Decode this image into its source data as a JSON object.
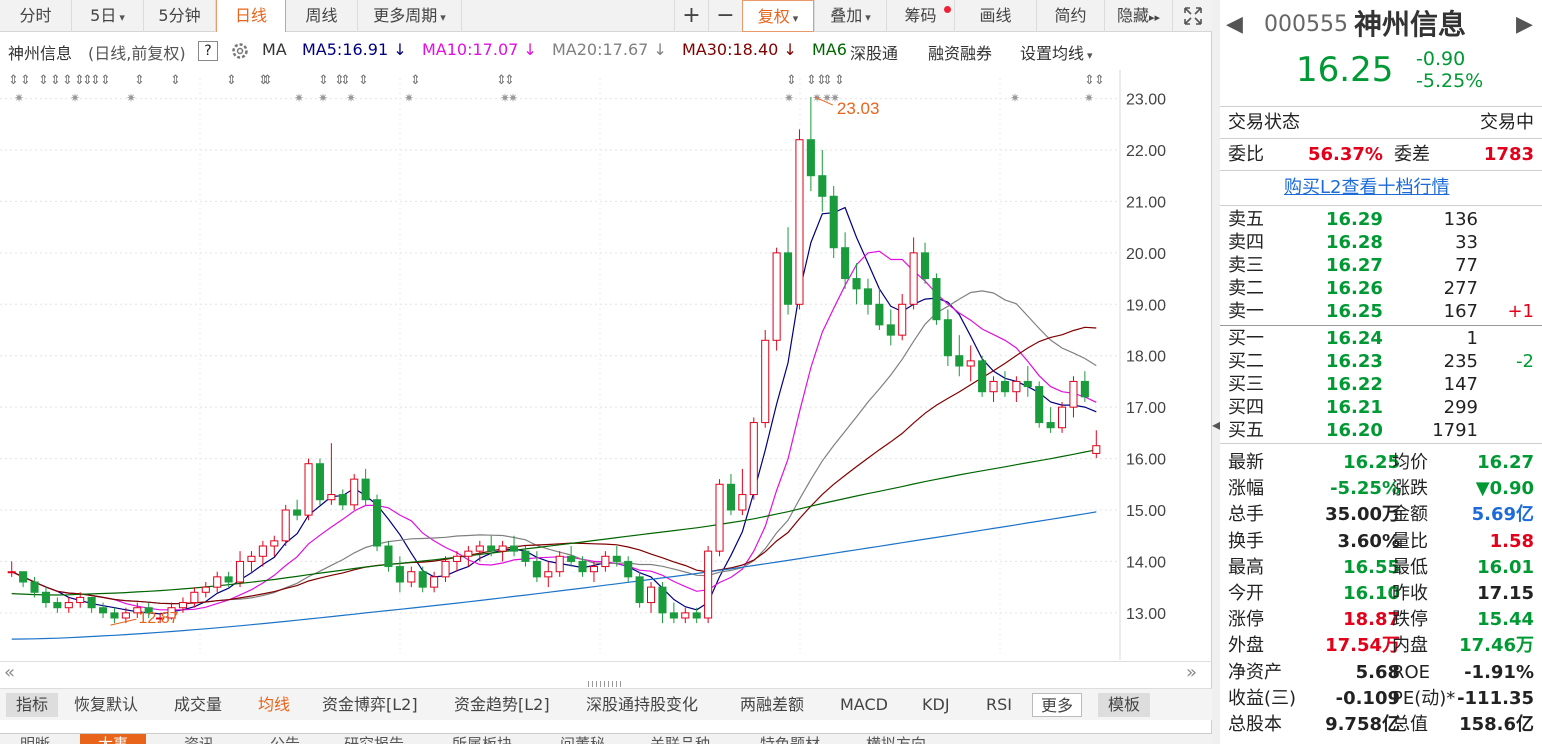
{
  "toolbar": {
    "tabs": [
      "分时",
      "5日",
      "5分钟",
      "日线",
      "周线",
      "更多周期"
    ],
    "plus": "+",
    "minus": "−",
    "fuquan": "复权",
    "overlay": "叠加",
    "chips": "筹码",
    "draw": "画线",
    "simple": "简约",
    "hide": "隐藏",
    "expand_icon": "expand-arrows"
  },
  "ma_bar": {
    "stock": "神州信息",
    "mode": "(日线,前复权)",
    "help": "?",
    "ma": "MA",
    "ma5": "MA5:16.91",
    "ma10": "MA10:17.07",
    "ma20": "MA20:17.67",
    "ma30": "MA30:18.40",
    "ma60": "MA6",
    "sgt": "深股通",
    "rzrq": "融资融券",
    "setma": "设置均线"
  },
  "colors": {
    "up": "#e2001a",
    "down": "#1a9b3c",
    "ma5": "#000080",
    "ma10": "#e010e0",
    "ma20": "#808080",
    "ma30": "#800000",
    "ma60": "#006600",
    "ma120": "#1c73c8",
    "accent": "#e8641b"
  },
  "chart_data": {
    "type": "candlestick",
    "y_ticks": [
      "23.00",
      "22.00",
      "21.00",
      "20.00",
      "19.00",
      "18.00",
      "17.00",
      "16.00",
      "15.00",
      "14.00",
      "13.00"
    ],
    "ylim": [
      12.2,
      23.4
    ],
    "high_label": "23.03",
    "low_label": "12.87",
    "candles": [
      [
        13.8,
        14.0,
        13.7,
        13.8
      ],
      [
        13.8,
        13.8,
        13.5,
        13.6
      ],
      [
        13.6,
        13.7,
        13.3,
        13.4
      ],
      [
        13.4,
        13.5,
        13.1,
        13.2
      ],
      [
        13.2,
        13.3,
        13.0,
        13.1
      ],
      [
        13.1,
        13.3,
        13.0,
        13.2
      ],
      [
        13.2,
        13.4,
        13.1,
        13.3
      ],
      [
        13.3,
        13.3,
        13.0,
        13.1
      ],
      [
        13.1,
        13.2,
        12.9,
        13.0
      ],
      [
        13.0,
        13.1,
        12.8,
        12.9
      ],
      [
        12.9,
        13.1,
        12.8,
        13.0
      ],
      [
        13.0,
        13.2,
        12.9,
        13.1
      ],
      [
        13.1,
        13.2,
        12.9,
        13.0
      ],
      [
        12.9,
        13.0,
        12.8,
        12.9
      ],
      [
        12.9,
        13.2,
        12.87,
        13.1
      ],
      [
        13.1,
        13.3,
        13.0,
        13.2
      ],
      [
        13.2,
        13.5,
        13.1,
        13.4
      ],
      [
        13.4,
        13.6,
        13.3,
        13.5
      ],
      [
        13.5,
        13.8,
        13.4,
        13.7
      ],
      [
        13.7,
        13.8,
        13.5,
        13.6
      ],
      [
        13.6,
        14.2,
        13.5,
        14.0
      ],
      [
        14.0,
        14.2,
        13.8,
        14.1
      ],
      [
        14.1,
        14.4,
        13.9,
        14.3
      ],
      [
        14.3,
        14.5,
        14.1,
        14.4
      ],
      [
        14.4,
        15.1,
        14.3,
        15.0
      ],
      [
        15.0,
        15.2,
        14.8,
        14.9
      ],
      [
        14.9,
        16.0,
        14.8,
        15.9
      ],
      [
        15.9,
        16.0,
        15.1,
        15.2
      ],
      [
        15.2,
        16.3,
        15.1,
        15.3
      ],
      [
        15.3,
        15.4,
        15.0,
        15.1
      ],
      [
        15.1,
        15.7,
        15.0,
        15.6
      ],
      [
        15.6,
        15.8,
        15.1,
        15.2
      ],
      [
        15.2,
        15.3,
        14.2,
        14.3
      ],
      [
        14.3,
        14.4,
        13.8,
        13.9
      ],
      [
        13.9,
        14.1,
        13.4,
        13.6
      ],
      [
        13.6,
        13.9,
        13.5,
        13.8
      ],
      [
        13.8,
        13.9,
        13.4,
        13.5
      ],
      [
        13.5,
        13.8,
        13.4,
        13.7
      ],
      [
        13.7,
        14.1,
        13.6,
        14.0
      ],
      [
        14.0,
        14.2,
        13.8,
        14.1
      ],
      [
        14.1,
        14.3,
        13.9,
        14.2
      ],
      [
        14.2,
        14.4,
        14.0,
        14.3
      ],
      [
        14.3,
        14.5,
        14.1,
        14.2
      ],
      [
        14.2,
        14.4,
        14.0,
        14.3
      ],
      [
        14.3,
        14.5,
        14.1,
        14.2
      ],
      [
        14.2,
        14.3,
        13.9,
        14.0
      ],
      [
        14.0,
        14.2,
        13.6,
        13.7
      ],
      [
        13.7,
        14.0,
        13.5,
        13.8
      ],
      [
        13.8,
        14.2,
        13.7,
        14.1
      ],
      [
        14.1,
        14.3,
        13.9,
        14.0
      ],
      [
        14.0,
        14.1,
        13.7,
        13.8
      ],
      [
        13.8,
        14.0,
        13.6,
        13.9
      ],
      [
        13.9,
        14.2,
        13.8,
        14.1
      ],
      [
        14.1,
        14.3,
        13.9,
        14.0
      ],
      [
        14.0,
        14.1,
        13.6,
        13.7
      ],
      [
        13.7,
        13.8,
        13.1,
        13.2
      ],
      [
        13.2,
        13.6,
        13.0,
        13.5
      ],
      [
        13.5,
        13.6,
        12.8,
        13.0
      ],
      [
        13.0,
        13.2,
        12.8,
        12.9
      ],
      [
        12.9,
        13.1,
        12.8,
        13.0
      ],
      [
        13.0,
        13.1,
        12.8,
        12.9
      ],
      [
        12.9,
        14.3,
        12.8,
        14.2
      ],
      [
        14.2,
        15.6,
        14.1,
        15.5
      ],
      [
        15.5,
        15.7,
        14.9,
        15.0
      ],
      [
        15.0,
        15.8,
        14.9,
        15.3
      ],
      [
        15.3,
        16.8,
        15.2,
        16.7
      ],
      [
        16.7,
        18.5,
        16.6,
        18.3
      ],
      [
        18.3,
        20.1,
        18.1,
        20.0
      ],
      [
        20.0,
        20.5,
        18.8,
        19.0
      ],
      [
        19.0,
        22.4,
        18.9,
        22.2
      ],
      [
        22.2,
        23.03,
        21.2,
        21.5
      ],
      [
        21.5,
        22.0,
        20.8,
        21.1
      ],
      [
        21.1,
        21.3,
        19.9,
        20.1
      ],
      [
        20.1,
        20.4,
        19.3,
        19.5
      ],
      [
        19.5,
        19.8,
        19.0,
        19.3
      ],
      [
        19.3,
        19.5,
        18.8,
        19.0
      ],
      [
        19.0,
        19.3,
        18.5,
        18.6
      ],
      [
        18.6,
        18.9,
        18.2,
        18.4
      ],
      [
        18.4,
        19.2,
        18.3,
        19.0
      ],
      [
        19.0,
        20.3,
        18.9,
        20.0
      ],
      [
        20.0,
        20.2,
        19.4,
        19.5
      ],
      [
        19.5,
        19.6,
        18.6,
        18.7
      ],
      [
        18.7,
        18.9,
        17.8,
        18.0
      ],
      [
        18.0,
        18.4,
        17.6,
        17.8
      ],
      [
        17.8,
        18.2,
        17.5,
        17.9
      ],
      [
        17.9,
        18.0,
        17.2,
        17.3
      ],
      [
        17.3,
        17.6,
        17.1,
        17.5
      ],
      [
        17.5,
        17.7,
        17.2,
        17.3
      ],
      [
        17.3,
        17.6,
        17.1,
        17.5
      ],
      [
        17.5,
        17.8,
        17.2,
        17.4
      ],
      [
        17.4,
        17.5,
        16.6,
        16.7
      ],
      [
        16.7,
        17.0,
        16.5,
        16.6
      ],
      [
        16.6,
        17.1,
        16.5,
        17.0
      ],
      [
        17.0,
        17.6,
        16.8,
        17.5
      ],
      [
        17.5,
        17.7,
        17.1,
        17.2
      ],
      [
        16.1,
        16.55,
        16.01,
        16.25
      ]
    ],
    "ma_lines": [
      "MA5",
      "MA10",
      "MA20",
      "MA30",
      "MA60",
      "MA120"
    ]
  },
  "indicator_bar": {
    "items": [
      "指标",
      "恢复默认",
      "成交量",
      "均线",
      "资金博弈[L2]",
      "资金趋势[L2]",
      "深股通持股变化",
      "两融差额",
      "MACD",
      "KDJ",
      "RSI",
      "更多",
      "模板"
    ]
  },
  "news_bar": {
    "items": [
      "明晰",
      "大事",
      "资讯",
      "公告",
      "研究报告",
      "所属板块",
      "问董秘",
      "关联品种",
      "特色题材",
      "横拟方向"
    ]
  },
  "quote": {
    "code": "000555",
    "name": "神州信息",
    "price": "16.25",
    "change": "-0.90",
    "change_pct": "-5.25%",
    "status_label": "交易状态",
    "status_value": "交易中",
    "weibi_label": "委比",
    "weibi_value": "56.37%",
    "weicha_label": "委差",
    "weicha_value": "1783",
    "l2_link": "购买L2查看十档行情",
    "asks": [
      {
        "label": "卖五",
        "price": "16.29",
        "vol": "136",
        "delta": ""
      },
      {
        "label": "卖四",
        "price": "16.28",
        "vol": "33",
        "delta": ""
      },
      {
        "label": "卖三",
        "price": "16.27",
        "vol": "77",
        "delta": ""
      },
      {
        "label": "卖二",
        "price": "16.26",
        "vol": "277",
        "delta": ""
      },
      {
        "label": "卖一",
        "price": "16.25",
        "vol": "167",
        "delta": "+1"
      }
    ],
    "bids": [
      {
        "label": "买一",
        "price": "16.24",
        "vol": "1",
        "delta": ""
      },
      {
        "label": "买二",
        "price": "16.23",
        "vol": "235",
        "delta": "-2"
      },
      {
        "label": "买三",
        "price": "16.22",
        "vol": "147",
        "delta": ""
      },
      {
        "label": "买四",
        "price": "16.21",
        "vol": "299",
        "delta": ""
      },
      {
        "label": "买五",
        "price": "16.20",
        "vol": "1791",
        "delta": ""
      }
    ],
    "stats": [
      {
        "l1": "最新",
        "v1": "16.25",
        "c1": "green",
        "l2": "均价",
        "v2": "16.27",
        "c2": "green"
      },
      {
        "l1": "涨幅",
        "v1": "-5.25%",
        "c1": "green",
        "l2": "涨跌",
        "v2": "▼0.90",
        "c2": "green"
      },
      {
        "l1": "总手",
        "v1": "35.00万",
        "c1": "",
        "l2": "金额",
        "v2": "5.69亿",
        "c2": "blue"
      },
      {
        "l1": "换手",
        "v1": "3.60%",
        "c1": "",
        "l2": "量比",
        "v2": "1.58",
        "c2": "red"
      },
      {
        "l1": "最高",
        "v1": "16.55",
        "c1": "green",
        "l2": "最低",
        "v2": "16.01",
        "c2": "green"
      },
      {
        "l1": "今开",
        "v1": "16.10",
        "c1": "green",
        "l2": "昨收",
        "v2": "17.15",
        "c2": ""
      },
      {
        "l1": "涨停",
        "v1": "18.87",
        "c1": "red",
        "l2": "跌停",
        "v2": "15.44",
        "c2": "green"
      },
      {
        "l1": "外盘",
        "v1": "17.54万",
        "c1": "red",
        "l2": "内盘",
        "v2": "17.46万",
        "c2": "green"
      },
      {
        "l1": "净资产",
        "v1": "5.68",
        "c1": "",
        "l2": "ROE",
        "v2": "-1.91%",
        "c2": ""
      },
      {
        "l1": "收益(三)",
        "v1": "-0.109",
        "c1": "",
        "l2": "PE(动)*",
        "v2": "-111.35",
        "c2": ""
      },
      {
        "l1": "总股本",
        "v1": "9.758亿",
        "c1": "",
        "l2": "总值",
        "v2": "158.6亿",
        "c2": ""
      }
    ]
  }
}
